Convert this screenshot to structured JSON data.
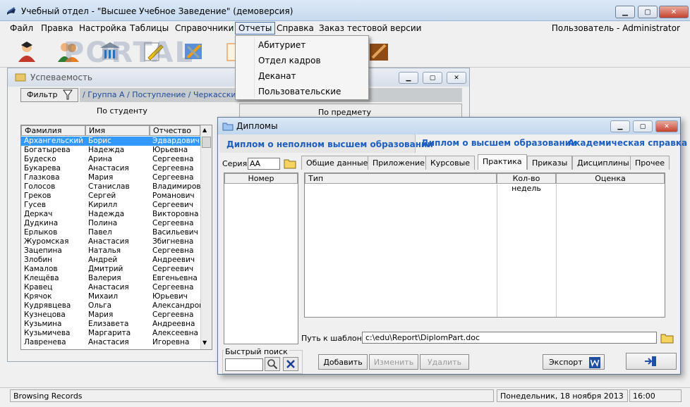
{
  "app": {
    "title": "Учебный отдел - \"Высшее Учебное Заведение\" (демоверсия)",
    "minimize": "▁",
    "maximize": "▢",
    "close": "✕"
  },
  "menu": {
    "items": [
      "Файл",
      "Правка",
      "Настройка",
      "Таблицы",
      "Справочники",
      "Отчеты",
      "Справка",
      "Заказ тестовой версии"
    ],
    "user": "Пользователь - Administrator"
  },
  "watermark": "PORTAL",
  "reports_menu": {
    "items": [
      "Абитуриет",
      "Отдел кадров",
      "Деканат",
      "Пользовательские"
    ]
  },
  "progress_window": {
    "title": "Успеваемость",
    "filter_label": "Фильтр",
    "breadcrumb": "/ Группа А / Поступление / Черкасский Се",
    "tab_by_student": "По студенту",
    "tab_by_subject": "По предмету",
    "columns": [
      "Фамилия",
      "Имя",
      "Отчество"
    ],
    "students": [
      [
        "Архангельский",
        "Борис",
        "Эдвардович"
      ],
      [
        "Богатырева",
        "Надежда",
        "Юрьевна"
      ],
      [
        "Будеско",
        "Арина",
        "Сергеевна"
      ],
      [
        "Букарева",
        "Анастасия",
        "Сергеевна"
      ],
      [
        "Глазкова",
        "Мария",
        "Сергеевна"
      ],
      [
        "Голосов",
        "Станислав",
        "Владимирови"
      ],
      [
        "Греков",
        "Сергей",
        "Романович"
      ],
      [
        "Гусев",
        "Кирилл",
        "Сергеевич"
      ],
      [
        "Деркач",
        "Надежда",
        "Викторовна"
      ],
      [
        "Дудкина",
        "Полина",
        "Сергеевна"
      ],
      [
        "Ерлыков",
        "Павел",
        "Васильевич"
      ],
      [
        "Журомская",
        "Анастасия",
        "Збигневна"
      ],
      [
        "Зацепина",
        "Наталья",
        " Сергеевна"
      ],
      [
        "Злобин",
        "Андрей",
        "Андреевич"
      ],
      [
        "Камалов",
        "Дмитрий",
        "Сергеевич"
      ],
      [
        "Клещёва",
        "Валерия",
        "Евгеньевна"
      ],
      [
        "Кравец",
        "Анастасия",
        "Сергеевна"
      ],
      [
        "Крячок",
        "Михаил",
        "Юрьевич"
      ],
      [
        "Кудрявцева",
        "Ольга",
        "Александров"
      ],
      [
        "Кузнецова",
        "Мария",
        "Сергеевна"
      ],
      [
        "Кузьмина",
        "Елизавета",
        "Андреевна"
      ],
      [
        "Кузьмичева",
        "Маргарита",
        "Алексеевна"
      ],
      [
        "Лавренева",
        "Анастасия",
        "Игоревна"
      ]
    ]
  },
  "diplomas": {
    "title": "Дипломы",
    "top_tabs": [
      "Диплом о неполном высшем образовании",
      "Диплом о высшем образовании",
      "Академическая справка"
    ],
    "series_label": "Серия:",
    "series_value": "АА",
    "number_column": "Номер",
    "sub_tabs": [
      "Общие данные",
      "Приложение",
      "Курсовые",
      "Практика",
      "Приказы",
      "Дисциплины",
      "Прочее"
    ],
    "active_sub_tab": "Практика",
    "practice_columns": [
      "Тип",
      "Кол-во недель",
      "Оценка"
    ],
    "template_label": "Путь к шаблону:",
    "template_path": "c:\\edu\\Report\\DiplomPart.doc",
    "quick_search_label": "Быстрый поиск",
    "add_button": "Добавить",
    "edit_button": "Изменить",
    "delete_button": "Удалить",
    "export_button": "Экспорт"
  },
  "status": {
    "left": "Browsing Records",
    "date": "Понедельник, 18 ноября 2013",
    "time": "16:00"
  }
}
